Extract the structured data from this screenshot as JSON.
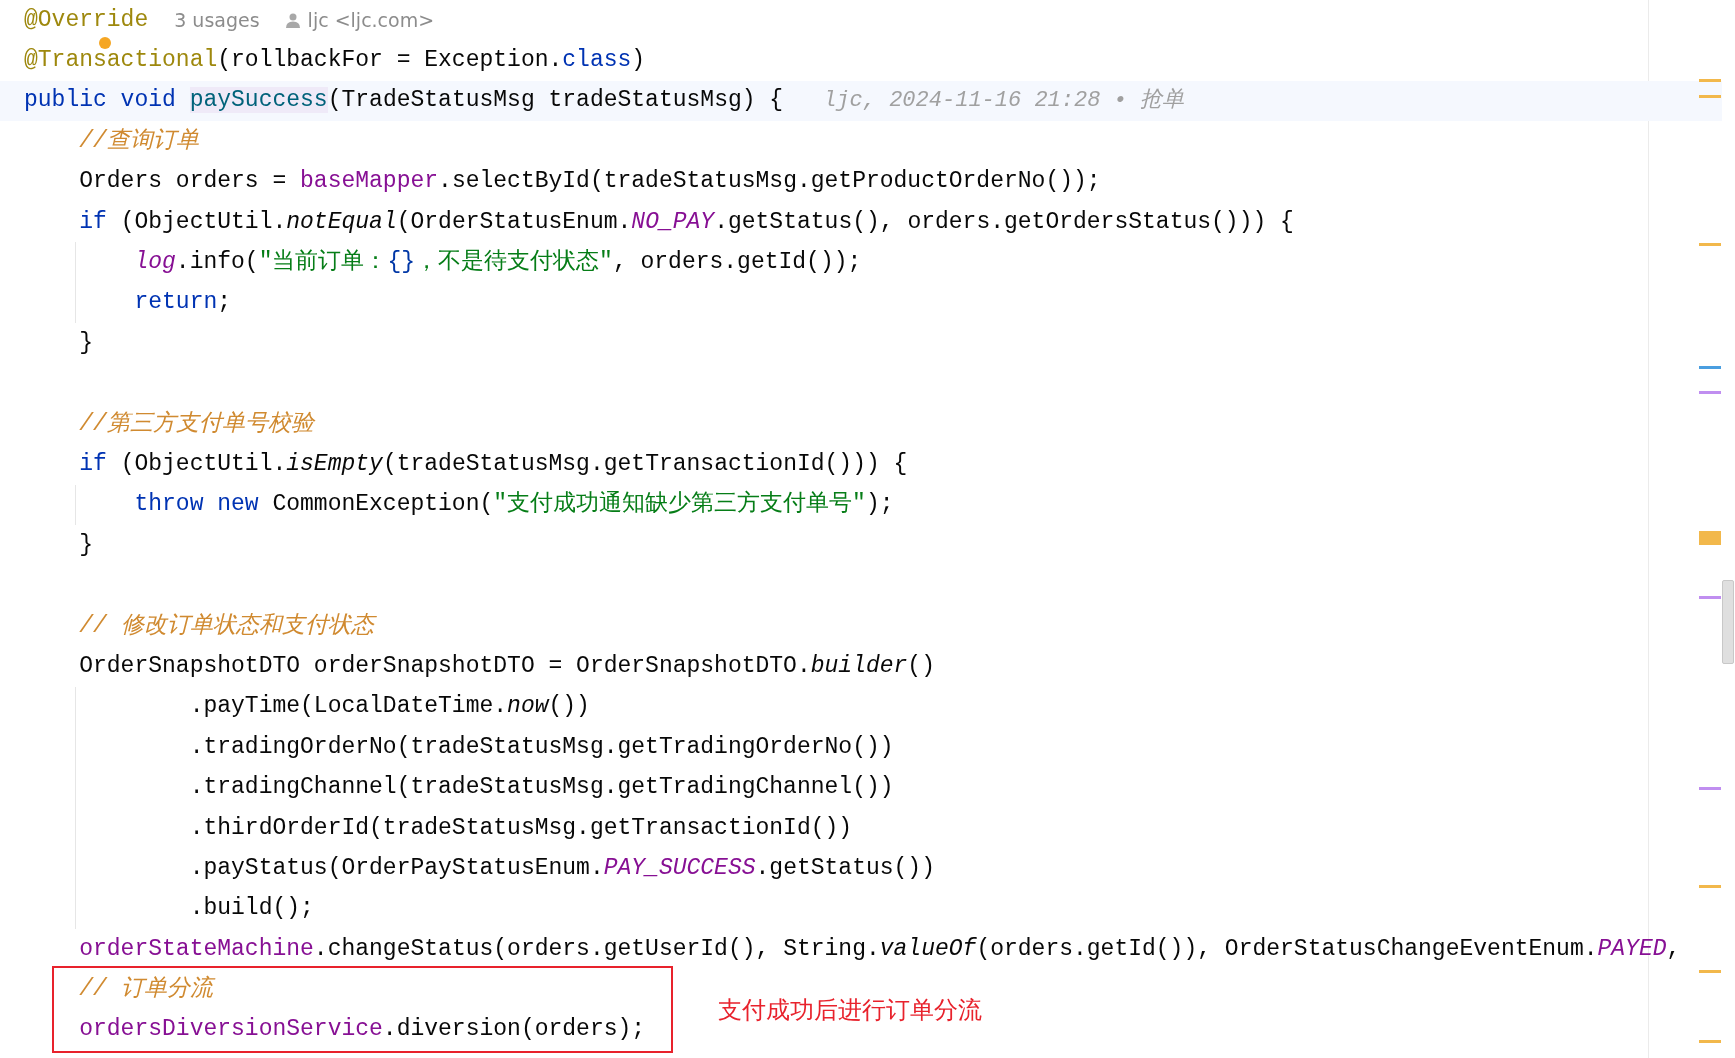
{
  "lines": [
    {
      "kind": "code",
      "tokens": [
        {
          "kind": "annotation",
          "text": "@Override"
        }
      ],
      "usages": "3 usages",
      "author": "ljc <ljc.com>"
    },
    {
      "kind": "code",
      "tokens": [
        {
          "kind": "annotation",
          "text": "@Transactional"
        },
        {
          "kind": "plain",
          "text": "(rollbackFor = Exception."
        },
        {
          "kind": "keyword",
          "text": "class"
        },
        {
          "kind": "plain",
          "text": ")"
        }
      ],
      "bulb": true
    },
    {
      "kind": "code",
      "current": true,
      "tokens": [
        {
          "kind": "keyword",
          "text": "public void "
        },
        {
          "kind": "method-decl",
          "text": "paySuccess"
        },
        {
          "kind": "plain",
          "text": "(TradeStatusMsg tradeStatusMsg) {"
        }
      ],
      "blame": "ljc, 2024-11-16 21:28 • 抢单"
    },
    {
      "kind": "code",
      "tokens": [
        {
          "kind": "comment",
          "text": "    //查询订单"
        }
      ]
    },
    {
      "kind": "code",
      "tokens": [
        {
          "kind": "plain",
          "text": "    Orders orders = "
        },
        {
          "kind": "field",
          "text": "baseMapper"
        },
        {
          "kind": "plain",
          "text": ".selectById(tradeStatusMsg.getProductOrderNo());"
        }
      ]
    },
    {
      "kind": "code",
      "tokens": [
        {
          "kind": "keyword",
          "text": "    if"
        },
        {
          "kind": "plain",
          "text": " (ObjectUtil."
        },
        {
          "kind": "static",
          "text": "notEqual"
        },
        {
          "kind": "plain",
          "text": "(OrderStatusEnum."
        },
        {
          "kind": "constant",
          "text": "NO_PAY"
        },
        {
          "kind": "plain",
          "text": ".getStatus(), orders.getOrdersStatus())) {"
        }
      ]
    },
    {
      "kind": "code",
      "tokens": [
        {
          "kind": "constant",
          "text": "        log"
        },
        {
          "kind": "plain",
          "text": ".info("
        },
        {
          "kind": "string",
          "text": "\"当前订单："
        },
        {
          "kind": "format",
          "text": "{}"
        },
        {
          "kind": "string",
          "text": "，不是待支付状态\""
        },
        {
          "kind": "plain",
          "text": ", orders.getId());"
        }
      ]
    },
    {
      "kind": "code",
      "tokens": [
        {
          "kind": "keyword",
          "text": "        return"
        },
        {
          "kind": "plain",
          "text": ";"
        }
      ]
    },
    {
      "kind": "code",
      "tokens": [
        {
          "kind": "plain",
          "text": "    }"
        }
      ]
    },
    {
      "kind": "blank"
    },
    {
      "kind": "code",
      "tokens": [
        {
          "kind": "comment",
          "text": "    //第三方支付单号校验"
        }
      ]
    },
    {
      "kind": "code",
      "tokens": [
        {
          "kind": "keyword",
          "text": "    if"
        },
        {
          "kind": "plain",
          "text": " (ObjectUtil."
        },
        {
          "kind": "static",
          "text": "isEmpty"
        },
        {
          "kind": "plain",
          "text": "(tradeStatusMsg.getTransactionId())) {"
        }
      ]
    },
    {
      "kind": "code",
      "tokens": [
        {
          "kind": "keyword",
          "text": "        throw new"
        },
        {
          "kind": "plain",
          "text": " CommonException("
        },
        {
          "kind": "string",
          "text": "\"支付成功通知缺少第三方支付单号\""
        },
        {
          "kind": "plain",
          "text": ");"
        }
      ]
    },
    {
      "kind": "code",
      "tokens": [
        {
          "kind": "plain",
          "text": "    }"
        }
      ]
    },
    {
      "kind": "blank"
    },
    {
      "kind": "code",
      "tokens": [
        {
          "kind": "comment",
          "text": "    // 修改订单状态和支付状态"
        }
      ]
    },
    {
      "kind": "code",
      "tokens": [
        {
          "kind": "plain",
          "text": "    OrderSnapshotDTO orderSnapshotDTO = OrderSnapshotDTO."
        },
        {
          "kind": "static",
          "text": "builder"
        },
        {
          "kind": "plain",
          "text": "()"
        }
      ]
    },
    {
      "kind": "code",
      "tokens": [
        {
          "kind": "plain",
          "text": "            .payTime(LocalDateTime."
        },
        {
          "kind": "static",
          "text": "now"
        },
        {
          "kind": "plain",
          "text": "())"
        }
      ]
    },
    {
      "kind": "code",
      "tokens": [
        {
          "kind": "plain",
          "text": "            .tradingOrderNo(tradeStatusMsg.getTradingOrderNo())"
        }
      ]
    },
    {
      "kind": "code",
      "tokens": [
        {
          "kind": "plain",
          "text": "            .tradingChannel(tradeStatusMsg.getTradingChannel())"
        }
      ]
    },
    {
      "kind": "code",
      "tokens": [
        {
          "kind": "plain",
          "text": "            .thirdOrderId(tradeStatusMsg.getTransactionId())"
        }
      ]
    },
    {
      "kind": "code",
      "tokens": [
        {
          "kind": "plain",
          "text": "            .payStatus(OrderPayStatusEnum."
        },
        {
          "kind": "constant",
          "text": "PAY_SUCCESS"
        },
        {
          "kind": "plain",
          "text": ".getStatus())"
        }
      ]
    },
    {
      "kind": "code",
      "tokens": [
        {
          "kind": "plain",
          "text": "            .build();"
        }
      ]
    },
    {
      "kind": "code",
      "tokens": [
        {
          "kind": "field",
          "text": "    orderStateMachine"
        },
        {
          "kind": "plain",
          "text": ".changeStatus(orders.getUserId(), String."
        },
        {
          "kind": "static",
          "text": "valueOf"
        },
        {
          "kind": "plain",
          "text": "(orders.getId()), OrderStatusChangeEventEnum."
        },
        {
          "kind": "constant",
          "text": "PAYED"
        },
        {
          "kind": "plain",
          "text": ","
        }
      ]
    }
  ],
  "callout": {
    "note": "支付成功后进行订单分流",
    "lines": [
      {
        "kind": "code",
        "tokens": [
          {
            "kind": "comment",
            "text": "    // 订单分流"
          }
        ]
      },
      {
        "kind": "code",
        "tokens": [
          {
            "kind": "field",
            "text": "    ordersDiversionService"
          },
          {
            "kind": "plain",
            "text": ".diversion(orders);"
          }
        ]
      }
    ]
  },
  "error_stripe": [
    {
      "color": "#f2b84b"
    },
    {
      "color": "#f2b84b"
    },
    {
      "color": "#f2b84b"
    },
    {
      "color": "#4a9ee0"
    },
    {
      "color": "#c08ef0"
    },
    {
      "color": "#f2b84b"
    },
    {
      "color": "#c08ef0"
    },
    {
      "color": "#c08ef0"
    },
    {
      "color": "#f2b84b"
    },
    {
      "color": "#f2b84b"
    },
    {
      "color": "#f2b84b"
    }
  ]
}
